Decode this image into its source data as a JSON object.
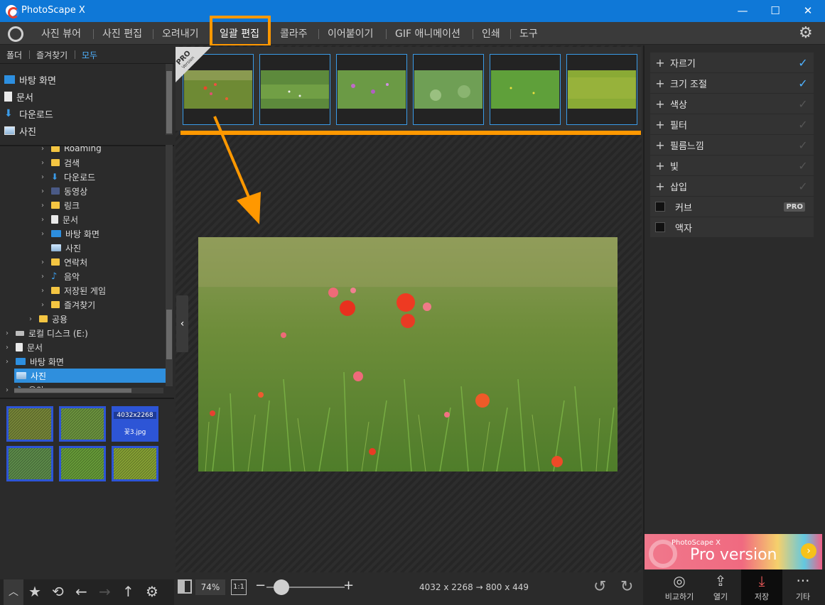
{
  "window": {
    "title": "PhotoScape X",
    "controls": {
      "minimize": "—",
      "maximize": "☐",
      "close": "✕"
    }
  },
  "menu": {
    "items": [
      "사진 뷰어",
      "사진 편집",
      "오려내기",
      "일괄 편집",
      "콜라주",
      "이어붙이기",
      "GIF 애니메이션",
      "인쇄",
      "도구"
    ],
    "active_index": 3,
    "highlight_color": "#ff9800"
  },
  "left_panel": {
    "tabs": [
      "폴더",
      "즐겨찾기",
      "모두"
    ],
    "active_tab": "모두",
    "quick_access": [
      {
        "label": "바탕 화면",
        "icon": "desktop-icon"
      },
      {
        "label": "문서",
        "icon": "document-icon"
      },
      {
        "label": "다운로드",
        "icon": "download-icon"
      },
      {
        "label": "사진",
        "icon": "pictures-icon"
      }
    ],
    "tree": [
      {
        "label": "Roaming",
        "icon": "folder-icon",
        "level": 3
      },
      {
        "label": "검색",
        "icon": "folder-icon",
        "level": 3
      },
      {
        "label": "다운로드",
        "icon": "download-icon",
        "level": 3
      },
      {
        "label": "동영상",
        "icon": "video-icon",
        "level": 3
      },
      {
        "label": "링크",
        "icon": "folder-icon",
        "level": 3
      },
      {
        "label": "문서",
        "icon": "document-icon",
        "level": 3
      },
      {
        "label": "바탕 화면",
        "icon": "desktop-icon",
        "level": 3
      },
      {
        "label": "사진",
        "icon": "pictures-icon",
        "level": 3
      },
      {
        "label": "연락처",
        "icon": "folder-icon",
        "level": 3
      },
      {
        "label": "음악",
        "icon": "music-icon",
        "level": 3
      },
      {
        "label": "저장된 게임",
        "icon": "folder-icon",
        "level": 3
      },
      {
        "label": "즐겨찾기",
        "icon": "folder-icon",
        "level": 3
      },
      {
        "label": "공용",
        "icon": "folder-icon",
        "level": 2
      },
      {
        "label": "로컬 디스크 (E:)",
        "icon": "drive-icon",
        "level": 1
      },
      {
        "label": "문서",
        "icon": "document-icon",
        "level": 1
      },
      {
        "label": "바탕 화면",
        "icon": "desktop-icon",
        "level": 1
      },
      {
        "label": "사진",
        "icon": "pictures-icon",
        "level": 1,
        "selected": true
      },
      {
        "label": "음악",
        "icon": "music-icon",
        "level": 1
      }
    ],
    "thumbnails": [
      {
        "name": "thumb-1"
      },
      {
        "name": "thumb-2"
      },
      {
        "name": "thumb-3",
        "dimensions": "4032x2268",
        "filename": "꽃3.jpg"
      },
      {
        "name": "thumb-4"
      },
      {
        "name": "thumb-5"
      },
      {
        "name": "thumb-6"
      }
    ]
  },
  "filmstrip": {
    "ribbon_title": "PRO",
    "ribbon_sub": "Version",
    "count": 6
  },
  "right_panel": {
    "items": [
      {
        "label": "자르기",
        "expandable": true,
        "checked": true
      },
      {
        "label": "크기 조절",
        "expandable": true,
        "checked": true
      },
      {
        "label": "색상",
        "expandable": true,
        "checked": false
      },
      {
        "label": "필터",
        "expandable": true,
        "checked": false
      },
      {
        "label": "필름느낌",
        "expandable": true,
        "checked": false
      },
      {
        "label": "빛",
        "expandable": true,
        "checked": false
      },
      {
        "label": "삽입",
        "expandable": true,
        "checked": false
      },
      {
        "label": "커브",
        "expandable": false,
        "pro": "PRO"
      },
      {
        "label": "액자",
        "expandable": false
      }
    ],
    "ad": {
      "small": "PhotoScape X",
      "big": "Pro version"
    }
  },
  "bottom_bar": {
    "zoom": "74%",
    "one_to_one": "1:1",
    "dimensions": "4032 x 2268 → 800 x 449"
  },
  "actions": [
    {
      "label": "비교하기",
      "icon": "compare-icon"
    },
    {
      "label": "열기",
      "icon": "upload-icon"
    },
    {
      "label": "저장",
      "icon": "save-icon",
      "active": true
    },
    {
      "label": "기타",
      "icon": "more-icon"
    }
  ],
  "colors": {
    "titlebar": "#0f78d7",
    "accent_blue": "#4fb2ff",
    "highlight_orange": "#ff9800",
    "selection": "#2f8fdd"
  }
}
